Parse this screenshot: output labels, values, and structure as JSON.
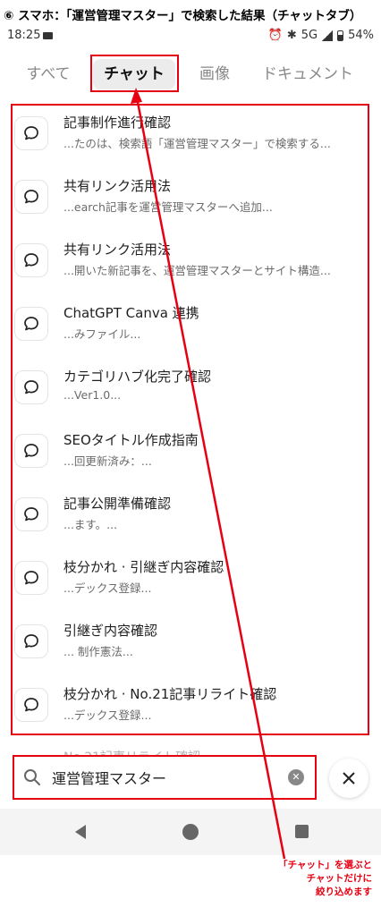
{
  "caption": "⑥ スマホ：「運営管理マスター」で検索した結果（チャットタブ）",
  "status_bar": {
    "time": "18:25",
    "icons": [
      "message-icon",
      "alarm-icon",
      "bluetooth-icon",
      "signal-icon",
      "battery-icon"
    ],
    "network": "5G",
    "battery": "54%"
  },
  "tabs": [
    {
      "label": "すべて",
      "active": false
    },
    {
      "label": "チャット",
      "active": true
    },
    {
      "label": "画像",
      "active": false
    },
    {
      "label": "ドキュメント",
      "active": false
    }
  ],
  "results": [
    {
      "title": "記事制作進行確認",
      "snippet": "...たのは、検索語「運営管理マスター」で検索する..."
    },
    {
      "title": "共有リンク活用法",
      "snippet": "...earch記事を運営管理マスターへ追加..."
    },
    {
      "title": "共有リンク活用法",
      "snippet": "...開いた新記事を、運営管理マスターとサイト構造..."
    },
    {
      "title": "ChatGPT Canva 連携",
      "snippet": "...みファイル..."
    },
    {
      "title": "カテゴリハブ化完了確認",
      "snippet": "...Ver1.0..."
    },
    {
      "title": "SEOタイトル作成指南",
      "snippet": "...回更新済み：..."
    },
    {
      "title": "記事公開準備確認",
      "snippet": "...ます。..."
    },
    {
      "title": "枝分かれ · 引継ぎ内容確認",
      "snippet": "...デックス登録..."
    },
    {
      "title": "引継ぎ内容確認",
      "snippet": "... 制作憲法..."
    },
    {
      "title": "枝分かれ · No.21記事リライト確認",
      "snippet": "...デックス登録..."
    }
  ],
  "partial_result_title": "No.21記事リライト確認",
  "search": {
    "value": "運営管理マスター",
    "clear_icon": "clear-icon",
    "search_icon": "search-icon"
  },
  "close_icon": "close-icon",
  "annotation": {
    "line1": "「チャット」を選ぶと",
    "line2": "チャットだけに",
    "line3": "絞り込めます"
  },
  "colors": {
    "highlight_red": "#e60012",
    "active_tab_bg": "#ececec",
    "muted_text": "#6b6b6b"
  }
}
